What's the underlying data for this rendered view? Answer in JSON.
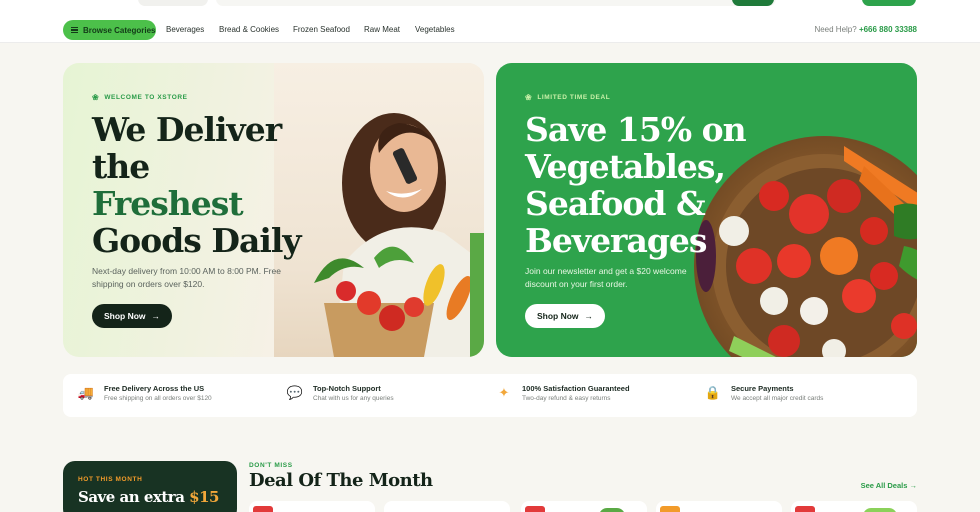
{
  "nav": {
    "browse_label": "Browse Categories",
    "links": [
      "Beverages",
      "Bread & Cookies",
      "Frozen Seafood",
      "Raw Meat",
      "Vegetables"
    ],
    "help_label": "Need Help?",
    "help_phone": "+666 880 33388"
  },
  "hero_left": {
    "kicker": "WELCOME TO XSTORE",
    "title_line1": "We Deliver",
    "title_line2": "the",
    "title_line3": "Freshest",
    "title_line4": "Goods Daily",
    "subtitle": "Next-day delivery from 10:00 AM to 8:00 PM. Free shipping on orders over $120.",
    "button": "Shop Now"
  },
  "hero_right": {
    "kicker": "LIMITED TIME DEAL",
    "title_line1": "Save 15% on",
    "title_line2": "Vegetables,",
    "title_line3": "Seafood &",
    "title_line4": "Beverages",
    "subtitle": "Join our newsletter and get a $20 welcome discount on your first order.",
    "button": "Shop Now"
  },
  "features": [
    {
      "icon": "truck-icon",
      "title": "Free Delivery Across the US",
      "desc": "Free shipping on all orders over $120"
    },
    {
      "icon": "chat-icon",
      "title": "Top-Notch Support",
      "desc": "Chat with us for any queries"
    },
    {
      "icon": "sparkle-icon",
      "title": "100% Satisfaction Guaranteed",
      "desc": "Two-day refund & easy returns"
    },
    {
      "icon": "lock-icon",
      "title": "Secure Payments",
      "desc": "We accept all major credit cards"
    }
  ],
  "promo": {
    "kicker": "HOT THIS MONTH",
    "title": "Save an extra",
    "amount": "$15"
  },
  "deals": {
    "kicker": "DON'T MISS",
    "title": "Deal Of The Month",
    "see_all": "See All Deals →"
  },
  "colors": {
    "accent": "#2ea34c",
    "dark": "#142419",
    "sale": "#e23a3a",
    "orange": "#f29b2a"
  }
}
